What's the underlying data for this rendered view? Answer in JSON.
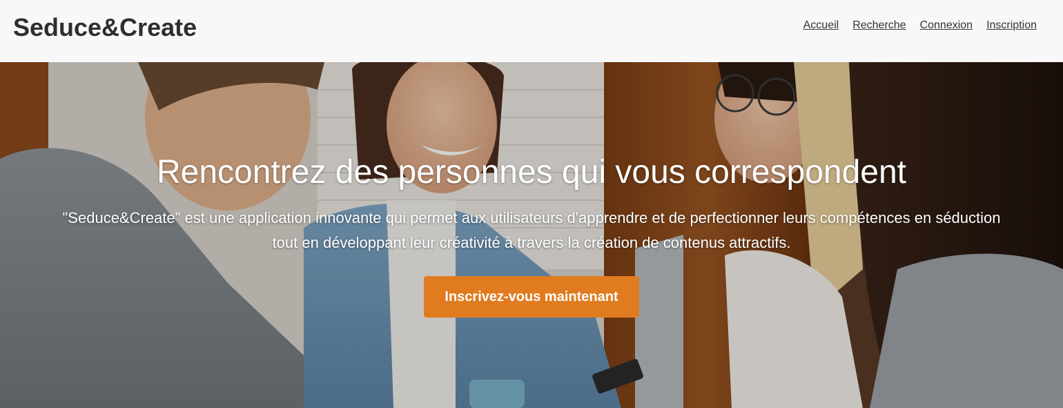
{
  "brand": {
    "name": "Seduce&Create"
  },
  "nav": {
    "items": [
      {
        "label": "Accueil"
      },
      {
        "label": "Recherche"
      },
      {
        "label": "Connexion"
      },
      {
        "label": "Inscription"
      }
    ]
  },
  "hero": {
    "title": "Rencontrez des personnes qui vous correspondent",
    "description_line1": "\"Seduce&Create\" est une application innovante qui permet aux utilisateurs d'apprendre et de perfectionner leurs compétences en séduction",
    "description_line2": "tout en développant leur créativité à travers la création de contenus attractifs.",
    "cta_label": "Inscrivez-vous maintenant",
    "image_subject": "friends-smiling-photo"
  },
  "colors": {
    "header_bg": "#f8f8f8",
    "cta_bg": "#e07b20",
    "text_dark": "#2e2e2e"
  }
}
